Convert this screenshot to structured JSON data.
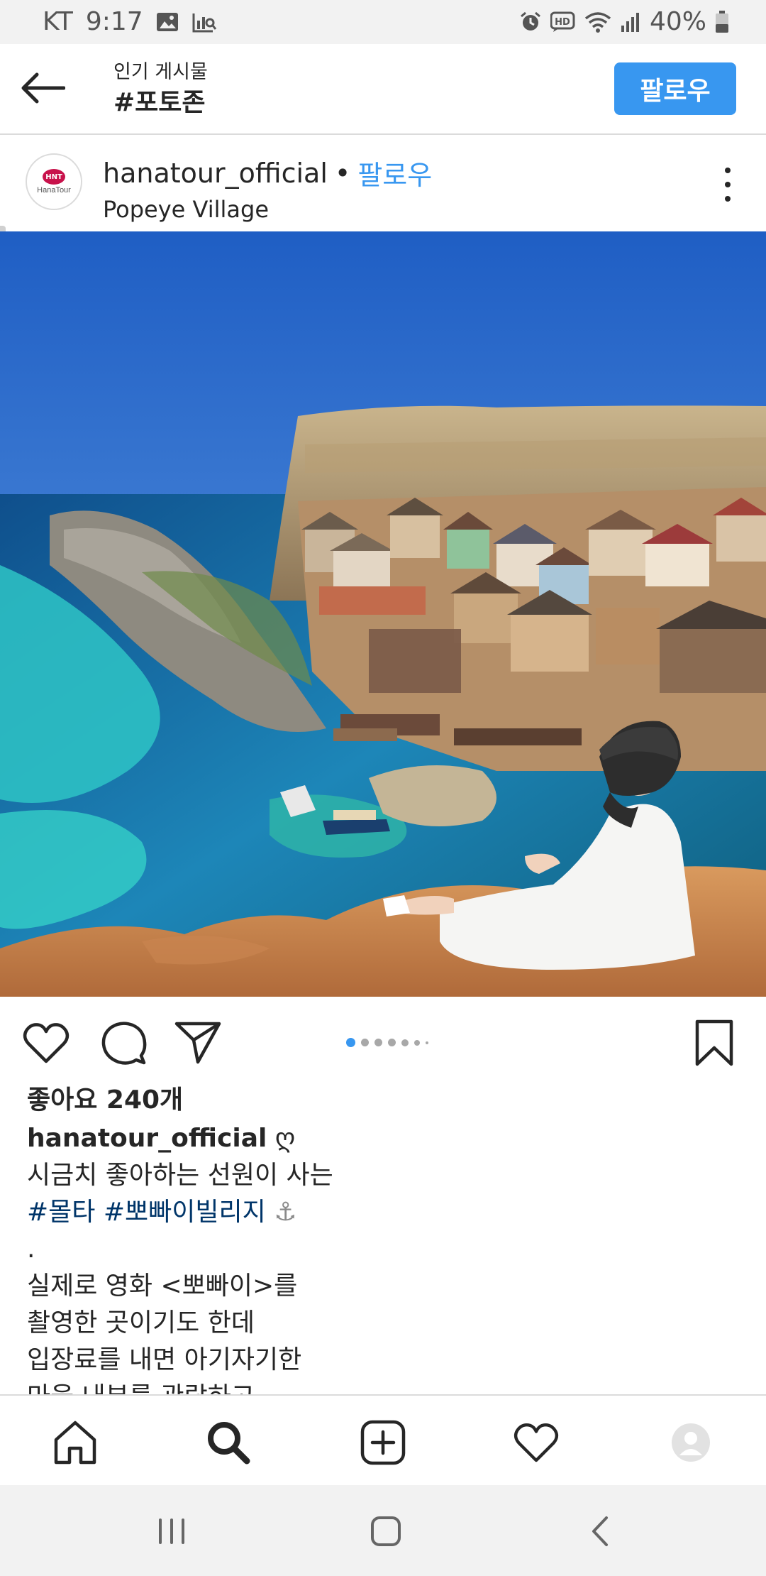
{
  "status_bar": {
    "carrier": "KT",
    "time": "9:17",
    "battery": "40%",
    "hd_label": "HD",
    "left_icons": [
      "image-icon",
      "chart-search-icon"
    ],
    "right_icons": [
      "alarm-icon",
      "hd-voice-icon",
      "wifi-icon",
      "signal-icon",
      "battery-icon"
    ]
  },
  "header": {
    "subtitle": "인기 게시물",
    "title": "#포토존",
    "follow_label": "팔로우",
    "back_icon": "arrow-left-icon"
  },
  "post": {
    "avatar_badge": "HNT",
    "avatar_text": "HanaTour",
    "username": "hanatour_official",
    "dot": "•",
    "follow_label": "팔로우",
    "location": "Popeye Village",
    "more_icon": "more-vertical-icon",
    "photo_icon": "landscape-photo",
    "carousel_count": 7,
    "carousel_active": 0
  },
  "actions": {
    "like_icon": "heart-icon",
    "comment_icon": "comment-icon",
    "share_icon": "paper-plane-icon",
    "save_icon": "bookmark-icon"
  },
  "caption": {
    "likes": "좋아요 240개",
    "username": "hanatour_official",
    "emoji": "ღ",
    "line1": "시금치 좋아하는 선원이 사는",
    "hashtags": [
      "#몰타",
      "#뽀빠이빌리지"
    ],
    "anchor": "⚓",
    "dot_line": ".",
    "line3": "실제로 영화 <뽀빠이>를",
    "line4": "촬영한 곳이기도 한데",
    "line5": "입장료를 내면 아기자기한",
    "line6": "마을 내부를 관람하고"
  },
  "bottom_nav": {
    "items": [
      "home-icon",
      "search-icon",
      "add-post-icon",
      "activity-heart-icon",
      "profile-avatar"
    ],
    "active": "search-icon"
  },
  "system_nav": {
    "items": [
      "recents-icon",
      "home-button-icon",
      "back-icon"
    ]
  },
  "colors": {
    "accent": "#3897f0",
    "hashtag": "#003569",
    "text": "#262626",
    "divider": "#dbdbdb"
  }
}
